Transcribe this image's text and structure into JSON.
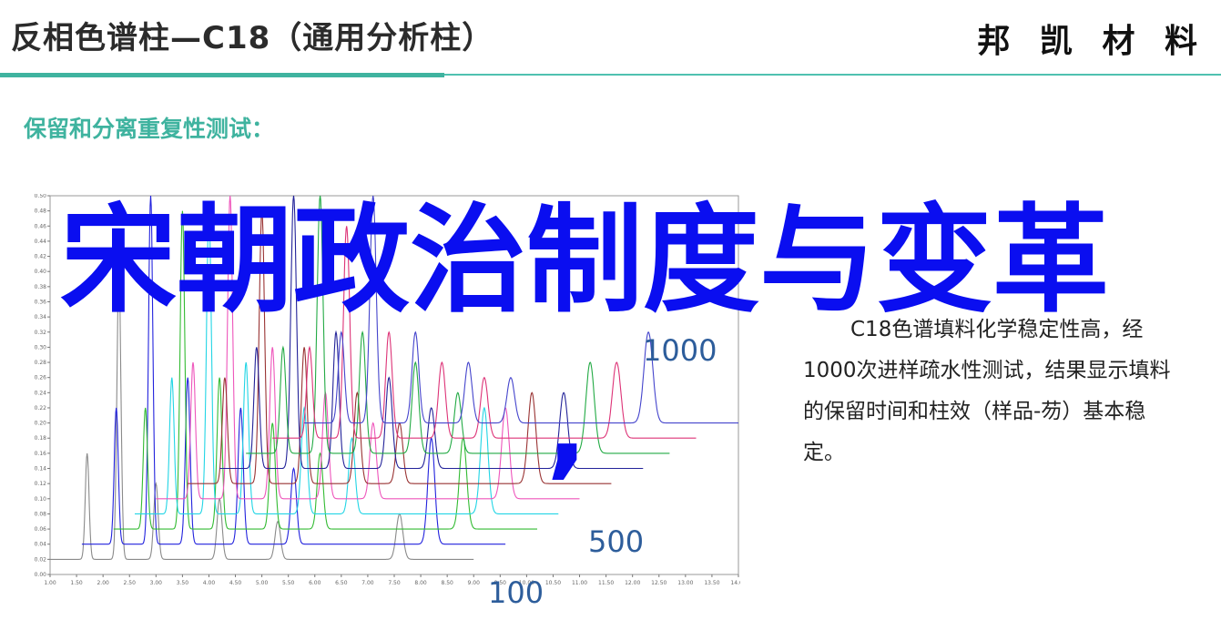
{
  "header": {
    "title": "反相色谱柱—C18（通用分析柱）",
    "brand": "邦 凯 材 料"
  },
  "section_heading": "保留和分离重复性测试：",
  "description": "C18色谱填料化学稳定性高，经1000次进样疏水性测试，结果显示填料的保留时间和柱效（样品-芴）基本稳定。",
  "overlay": {
    "title": "宋朝政治制度与变革",
    "comma": ",",
    "labels": {
      "top": "1000",
      "middle": "500",
      "bottom": "100"
    }
  },
  "colors": {
    "accent": "#3fb39f",
    "overlay_text": "#0a0ef0",
    "injection_label": "#2d5d9b"
  },
  "chart_data": {
    "type": "line",
    "title": "",
    "xlabel": "",
    "ylabel": "",
    "xlim": [
      1.0,
      14.0
    ],
    "ylim": [
      0.0,
      0.5
    ],
    "x_ticks": [
      "1.00",
      "1.50",
      "2.00",
      "2.50",
      "3.00",
      "3.50",
      "4.00",
      "4.50",
      "5.00",
      "5.50",
      "6.00",
      "6.50",
      "7.00",
      "7.50",
      "8.00",
      "8.50",
      "9.00",
      "9.50",
      "10.00",
      "10.50",
      "11.00",
      "11.50",
      "12.00",
      "12.50",
      "13.00",
      "13.50",
      "14.00"
    ],
    "y_ticks": [
      "0.00",
      "0.02",
      "0.04",
      "0.06",
      "0.08",
      "0.10",
      "0.12",
      "0.14",
      "0.16",
      "0.18",
      "0.20",
      "0.22",
      "0.24",
      "0.26",
      "0.28",
      "0.30",
      "0.32",
      "0.34",
      "0.36",
      "0.38",
      "0.40",
      "0.42",
      "0.44",
      "0.46",
      "0.48",
      "0.50"
    ],
    "injection_labels": [
      "100",
      "500",
      "1000"
    ],
    "series": [
      {
        "color": "#8a8a8a",
        "x_start": 1.0,
        "x_end": 9.0,
        "baseline": 0.02,
        "peaks": [
          {
            "x": 1.7,
            "h": 0.14
          },
          {
            "x": 2.3,
            "h": 0.38
          },
          {
            "x": 3.0,
            "h": 0.1
          },
          {
            "x": 4.2,
            "h": 0.08
          },
          {
            "x": 5.3,
            "h": 0.05
          },
          {
            "x": 7.6,
            "h": 0.06
          }
        ]
      },
      {
        "color": "#2222dd",
        "x_start": 1.6,
        "x_end": 9.6,
        "baseline": 0.04,
        "peaks": [
          {
            "x": 2.25,
            "h": 0.18
          },
          {
            "x": 2.9,
            "h": 0.46
          },
          {
            "x": 3.6,
            "h": 0.22
          },
          {
            "x": 4.6,
            "h": 0.18
          },
          {
            "x": 5.6,
            "h": 0.1
          },
          {
            "x": 8.2,
            "h": 0.14
          }
        ]
      },
      {
        "color": "#33bb33",
        "x_start": 2.2,
        "x_end": 10.2,
        "baseline": 0.06,
        "peaks": [
          {
            "x": 2.8,
            "h": 0.16
          },
          {
            "x": 3.5,
            "h": 0.42
          },
          {
            "x": 4.2,
            "h": 0.2
          },
          {
            "x": 5.2,
            "h": 0.14
          },
          {
            "x": 6.1,
            "h": 0.1
          },
          {
            "x": 8.8,
            "h": 0.12
          }
        ]
      },
      {
        "color": "#22d5e5",
        "x_start": 2.6,
        "x_end": 10.6,
        "baseline": 0.08,
        "peaks": [
          {
            "x": 3.3,
            "h": 0.18
          },
          {
            "x": 4.0,
            "h": 0.4
          },
          {
            "x": 4.7,
            "h": 0.2
          },
          {
            "x": 5.8,
            "h": 0.14
          },
          {
            "x": 6.7,
            "h": 0.1
          },
          {
            "x": 9.2,
            "h": 0.14
          }
        ]
      },
      {
        "color": "#ee55bb",
        "x_start": 3.0,
        "x_end": 11.0,
        "baseline": 0.1,
        "peaks": [
          {
            "x": 3.7,
            "h": 0.18
          },
          {
            "x": 4.4,
            "h": 0.4
          },
          {
            "x": 5.2,
            "h": 0.2
          },
          {
            "x": 6.2,
            "h": 0.14
          },
          {
            "x": 7.1,
            "h": 0.1
          },
          {
            "x": 9.6,
            "h": 0.12
          }
        ]
      },
      {
        "color": "#993333",
        "x_start": 3.6,
        "x_end": 11.6,
        "baseline": 0.12,
        "peaks": [
          {
            "x": 4.3,
            "h": 0.14
          },
          {
            "x": 5.0,
            "h": 0.36
          },
          {
            "x": 5.8,
            "h": 0.18
          },
          {
            "x": 6.8,
            "h": 0.12
          },
          {
            "x": 7.6,
            "h": 0.08
          },
          {
            "x": 10.1,
            "h": 0.12
          }
        ]
      },
      {
        "color": "#222299",
        "x_start": 4.2,
        "x_end": 12.2,
        "baseline": 0.14,
        "peaks": [
          {
            "x": 4.9,
            "h": 0.16
          },
          {
            "x": 5.6,
            "h": 0.36
          },
          {
            "x": 6.4,
            "h": 0.18
          },
          {
            "x": 7.4,
            "h": 0.12
          },
          {
            "x": 8.2,
            "h": 0.08
          },
          {
            "x": 10.7,
            "h": 0.1
          }
        ]
      },
      {
        "color": "#22aa44",
        "x_start": 4.7,
        "x_end": 12.7,
        "baseline": 0.16,
        "peaks": [
          {
            "x": 5.4,
            "h": 0.14
          },
          {
            "x": 6.1,
            "h": 0.34
          },
          {
            "x": 6.9,
            "h": 0.16
          },
          {
            "x": 7.9,
            "h": 0.12
          },
          {
            "x": 8.7,
            "h": 0.08
          },
          {
            "x": 11.2,
            "h": 0.12
          }
        ]
      },
      {
        "color": "#dd3377",
        "x_start": 5.2,
        "x_end": 13.2,
        "baseline": 0.18,
        "peaks": [
          {
            "x": 5.9,
            "h": 0.12
          },
          {
            "x": 6.6,
            "h": 0.28
          },
          {
            "x": 7.4,
            "h": 0.14
          },
          {
            "x": 8.4,
            "h": 0.1
          },
          {
            "x": 9.2,
            "h": 0.08
          },
          {
            "x": 11.7,
            "h": 0.1
          }
        ]
      },
      {
        "color": "#4444cc",
        "x_start": 5.8,
        "x_end": 14.0,
        "baseline": 0.2,
        "peaks": [
          {
            "x": 6.5,
            "h": 0.12
          },
          {
            "x": 7.1,
            "h": 0.3
          },
          {
            "x": 7.9,
            "h": 0.12
          },
          {
            "x": 8.9,
            "h": 0.08
          },
          {
            "x": 9.7,
            "h": 0.06
          },
          {
            "x": 12.3,
            "h": 0.12
          }
        ]
      }
    ]
  }
}
